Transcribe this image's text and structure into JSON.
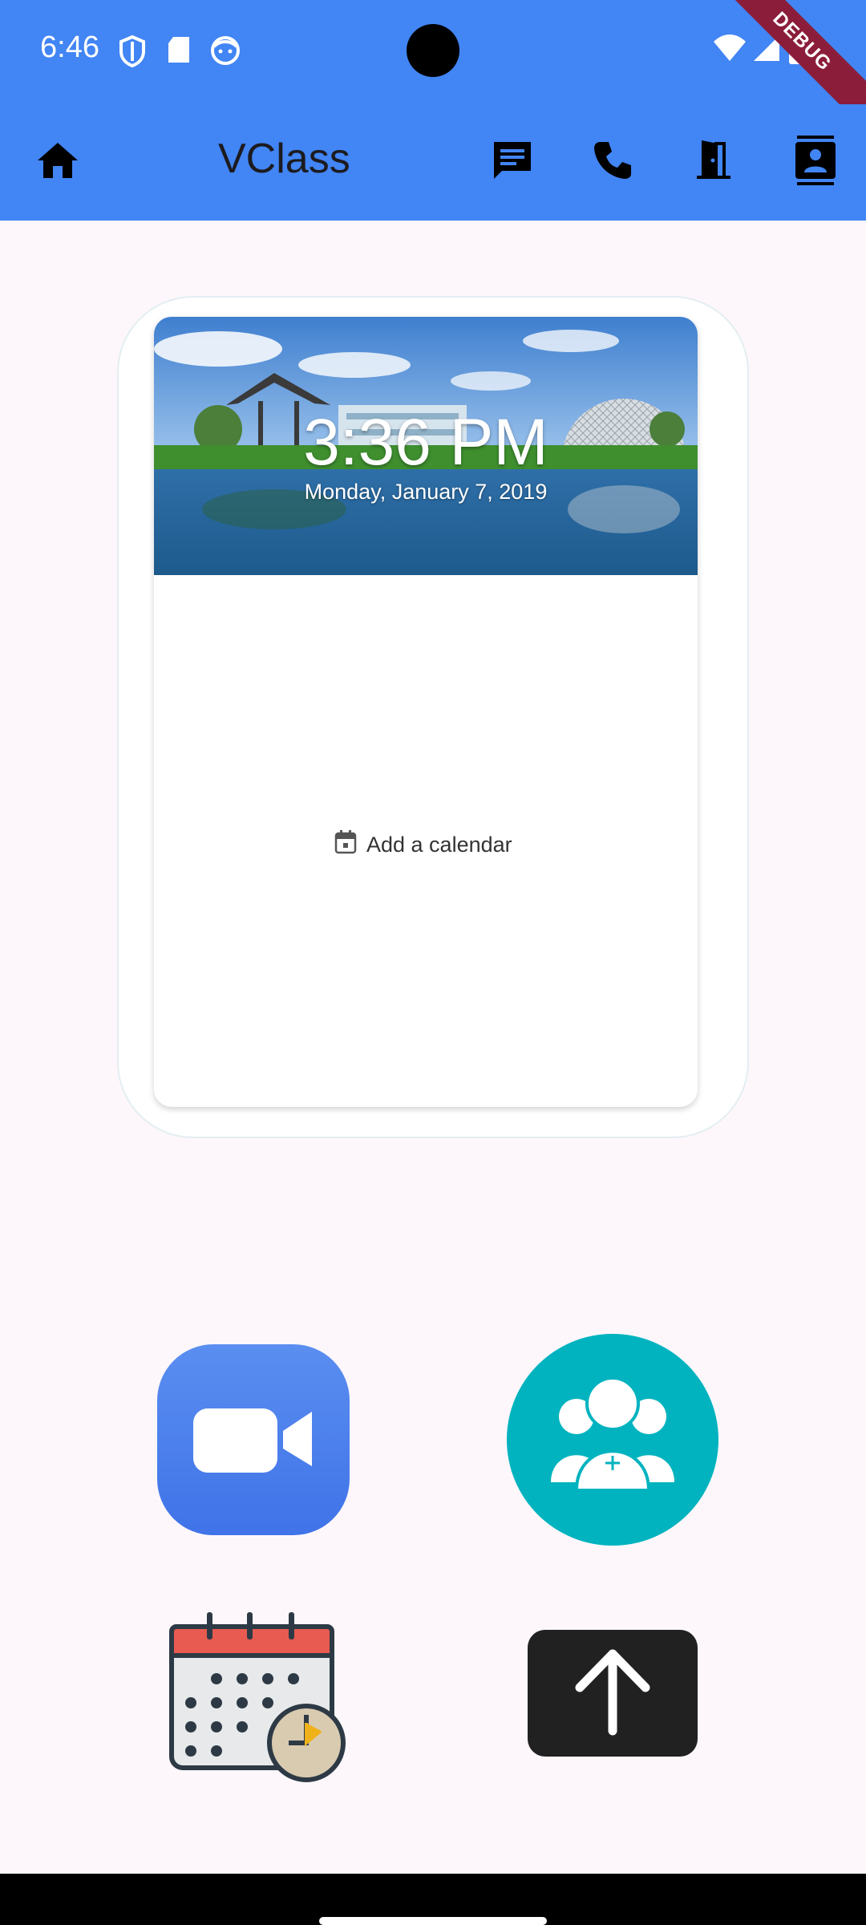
{
  "status_bar": {
    "time": "6:46",
    "debug_label": "DEBUG",
    "background": "#4285f4",
    "icons": [
      "shield-icon",
      "sd-card-icon",
      "face-icon",
      "wifi-icon",
      "signal-icon",
      "battery-icon"
    ]
  },
  "app_bar": {
    "title": "VClass",
    "background": "#4285f4",
    "actions": [
      "home-icon",
      "chat-icon",
      "phone-icon",
      "exit-door-icon",
      "contacts-icon"
    ]
  },
  "clock_card": {
    "time": "3:36 PM",
    "date": "Monday, January 7, 2019",
    "add_calendar_label": "Add a calendar"
  },
  "tiles": [
    {
      "name": "video-call-tile",
      "icon": "video-camera-icon",
      "color": "#4a7ff0"
    },
    {
      "name": "group-add-tile",
      "icon": "people-add-icon",
      "color": "#00b3bf"
    },
    {
      "name": "schedule-tile",
      "icon": "calendar-clock-icon",
      "color": "#e85b50"
    },
    {
      "name": "upload-tile",
      "icon": "arrow-up-icon",
      "color": "#212121"
    }
  ]
}
